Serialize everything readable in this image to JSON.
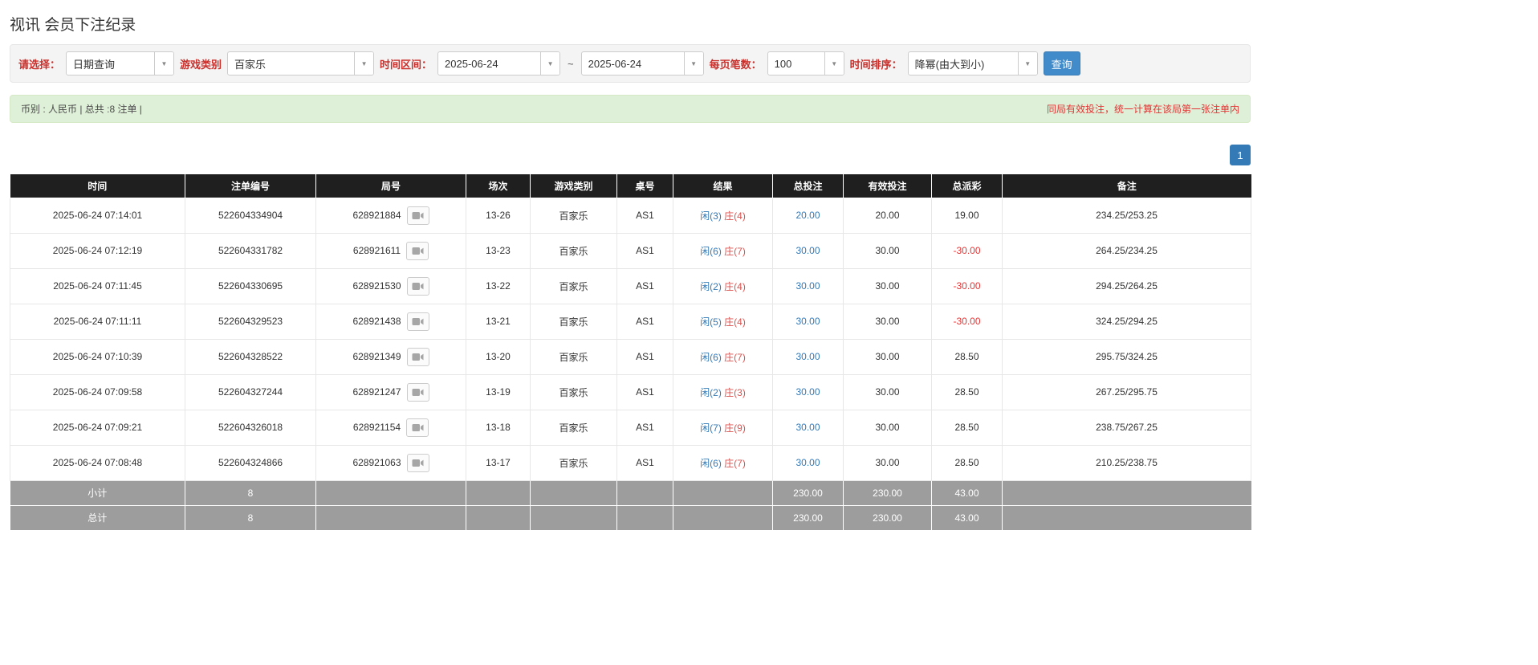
{
  "page_title": "视讯 会员下注纪录",
  "filters": {
    "select_label": "请选择：",
    "select_value": "日期查询",
    "game_type_label": "游戏类别",
    "game_type_value": "百家乐",
    "time_range_label": "时间区间：",
    "date_from": "2025-06-24",
    "range_separator": "~",
    "date_to": "2025-06-24",
    "page_size_label": "每页笔数：",
    "page_size_value": "100",
    "sort_label": "时间排序：",
    "sort_value": "降幂(由大到小)",
    "query_button_label": "查询"
  },
  "summary": {
    "left_text": "币别 : 人民币 | 总共 :8 注单 |",
    "right_text": "同局有效投注，统一计算在该局第一张注单内"
  },
  "pagination": {
    "current_page": "1"
  },
  "colors": {
    "accent_blue": "#337ab7",
    "danger_red": "#e53333",
    "success_bar_bg": "#dff0d8",
    "table_header_bg": "#1f1f1f",
    "table_footer_bg": "#9d9d9d",
    "query_button_bg": "#428bca"
  },
  "table": {
    "headers": [
      "时间",
      "注单编号",
      "局号",
      "场次",
      "游戏类别",
      "桌号",
      "结果",
      "总投注",
      "有效投注",
      "总派彩",
      "备注"
    ],
    "rows": [
      {
        "time": "2025-06-24 07:14:01",
        "bet_id": "522604334904",
        "round_id": "628921884",
        "session": "13-26",
        "game_type": "百家乐",
        "table_no": "AS1",
        "result_player": "闲(3)",
        "result_banker": "庄(4)",
        "total_bet": "20.00",
        "valid_bet": "20.00",
        "payout": "19.00",
        "note": "234.25/253.25"
      },
      {
        "time": "2025-06-24 07:12:19",
        "bet_id": "522604331782",
        "round_id": "628921611",
        "session": "13-23",
        "game_type": "百家乐",
        "table_no": "AS1",
        "result_player": "闲(6)",
        "result_banker": "庄(7)",
        "total_bet": "30.00",
        "valid_bet": "30.00",
        "payout": "-30.00",
        "note": "264.25/234.25"
      },
      {
        "time": "2025-06-24 07:11:45",
        "bet_id": "522604330695",
        "round_id": "628921530",
        "session": "13-22",
        "game_type": "百家乐",
        "table_no": "AS1",
        "result_player": "闲(2)",
        "result_banker": "庄(4)",
        "total_bet": "30.00",
        "valid_bet": "30.00",
        "payout": "-30.00",
        "note": "294.25/264.25"
      },
      {
        "time": "2025-06-24 07:11:11",
        "bet_id": "522604329523",
        "round_id": "628921438",
        "session": "13-21",
        "game_type": "百家乐",
        "table_no": "AS1",
        "result_player": "闲(5)",
        "result_banker": "庄(4)",
        "total_bet": "30.00",
        "valid_bet": "30.00",
        "payout": "-30.00",
        "note": "324.25/294.25"
      },
      {
        "time": "2025-06-24 07:10:39",
        "bet_id": "522604328522",
        "round_id": "628921349",
        "session": "13-20",
        "game_type": "百家乐",
        "table_no": "AS1",
        "result_player": "闲(6)",
        "result_banker": "庄(7)",
        "total_bet": "30.00",
        "valid_bet": "30.00",
        "payout": "28.50",
        "note": "295.75/324.25"
      },
      {
        "time": "2025-06-24 07:09:58",
        "bet_id": "522604327244",
        "round_id": "628921247",
        "session": "13-19",
        "game_type": "百家乐",
        "table_no": "AS1",
        "result_player": "闲(2)",
        "result_banker": "庄(3)",
        "total_bet": "30.00",
        "valid_bet": "30.00",
        "payout": "28.50",
        "note": "267.25/295.75"
      },
      {
        "time": "2025-06-24 07:09:21",
        "bet_id": "522604326018",
        "round_id": "628921154",
        "session": "13-18",
        "game_type": "百家乐",
        "table_no": "AS1",
        "result_player": "闲(7)",
        "result_banker": "庄(9)",
        "total_bet": "30.00",
        "valid_bet": "30.00",
        "payout": "28.50",
        "note": "238.75/267.25"
      },
      {
        "time": "2025-06-24 07:08:48",
        "bet_id": "522604324866",
        "round_id": "628921063",
        "session": "13-17",
        "game_type": "百家乐",
        "table_no": "AS1",
        "result_player": "闲(6)",
        "result_banker": "庄(7)",
        "total_bet": "30.00",
        "valid_bet": "30.00",
        "payout": "28.50",
        "note": "210.25/238.75"
      }
    ],
    "subtotal": {
      "label": "小计",
      "count": "8",
      "total_bet": "230.00",
      "valid_bet": "230.00",
      "payout": "43.00"
    },
    "grand_total": {
      "label": "总计",
      "count": "8",
      "total_bet": "230.00",
      "valid_bet": "230.00",
      "payout": "43.00"
    }
  }
}
